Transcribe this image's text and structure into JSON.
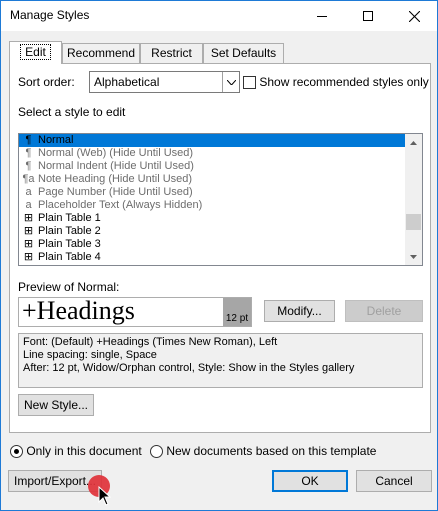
{
  "window": {
    "title": "Manage Styles"
  },
  "tabs": [
    {
      "label": "Edit",
      "active": true
    },
    {
      "label": "Recommend",
      "active": false
    },
    {
      "label": "Restrict",
      "active": false
    },
    {
      "label": "Set Defaults",
      "active": false
    }
  ],
  "sort": {
    "label": "Sort order:",
    "value": "Alphabetical"
  },
  "show_recommended": {
    "label": "Show recommended styles only",
    "checked": false
  },
  "select_label": "Select a style to edit",
  "styles": [
    {
      "icon": "¶",
      "icon_name": "paragraph-icon",
      "name": "Normal",
      "selected": true,
      "dark": true
    },
    {
      "icon": "¶",
      "icon_name": "paragraph-icon",
      "name": "Normal (Web)  (Hide Until Used)",
      "selected": false,
      "dark": false
    },
    {
      "icon": "¶",
      "icon_name": "paragraph-icon",
      "name": "Normal Indent  (Hide Until Used)",
      "selected": false,
      "dark": false
    },
    {
      "icon": "¶a",
      "icon_name": "linked-style-icon",
      "name": "Note Heading  (Hide Until Used)",
      "selected": false,
      "dark": false
    },
    {
      "icon": "a",
      "icon_name": "character-style-icon",
      "name": "Page Number  (Hide Until Used)",
      "selected": false,
      "dark": false
    },
    {
      "icon": "a",
      "icon_name": "character-style-icon",
      "name": "Placeholder Text  (Always Hidden)",
      "selected": false,
      "dark": false
    },
    {
      "icon": "⊞",
      "icon_name": "table-style-icon",
      "name": "Plain Table 1",
      "selected": false,
      "dark": true
    },
    {
      "icon": "⊞",
      "icon_name": "table-style-icon",
      "name": "Plain Table 2",
      "selected": false,
      "dark": true
    },
    {
      "icon": "⊞",
      "icon_name": "table-style-icon",
      "name": "Plain Table 3",
      "selected": false,
      "dark": true
    },
    {
      "icon": "⊞",
      "icon_name": "table-style-icon",
      "name": "Plain Table 4",
      "selected": false,
      "dark": true
    }
  ],
  "preview": {
    "label": "Preview of Normal:",
    "text": "+Headings",
    "size": "12 pt"
  },
  "buttons": {
    "modify": "Modify...",
    "delete": "Delete",
    "new_style": "New Style...",
    "import_export": "Import/Export...",
    "ok": "OK",
    "cancel": "Cancel"
  },
  "description": [
    "Font: (Default) +Headings (Times New Roman), Left",
    "   Line spacing:  single, Space",
    "   After:  12 pt, Widow/Orphan control, Style: Show in the Styles gallery"
  ],
  "scope": {
    "option1": "Only in this document",
    "option2": "New documents based on this template",
    "selected": "option1"
  },
  "colors": {
    "accent": "#0078d7",
    "border": "#1e7ad6",
    "cursor_dot": "#e0323a"
  }
}
